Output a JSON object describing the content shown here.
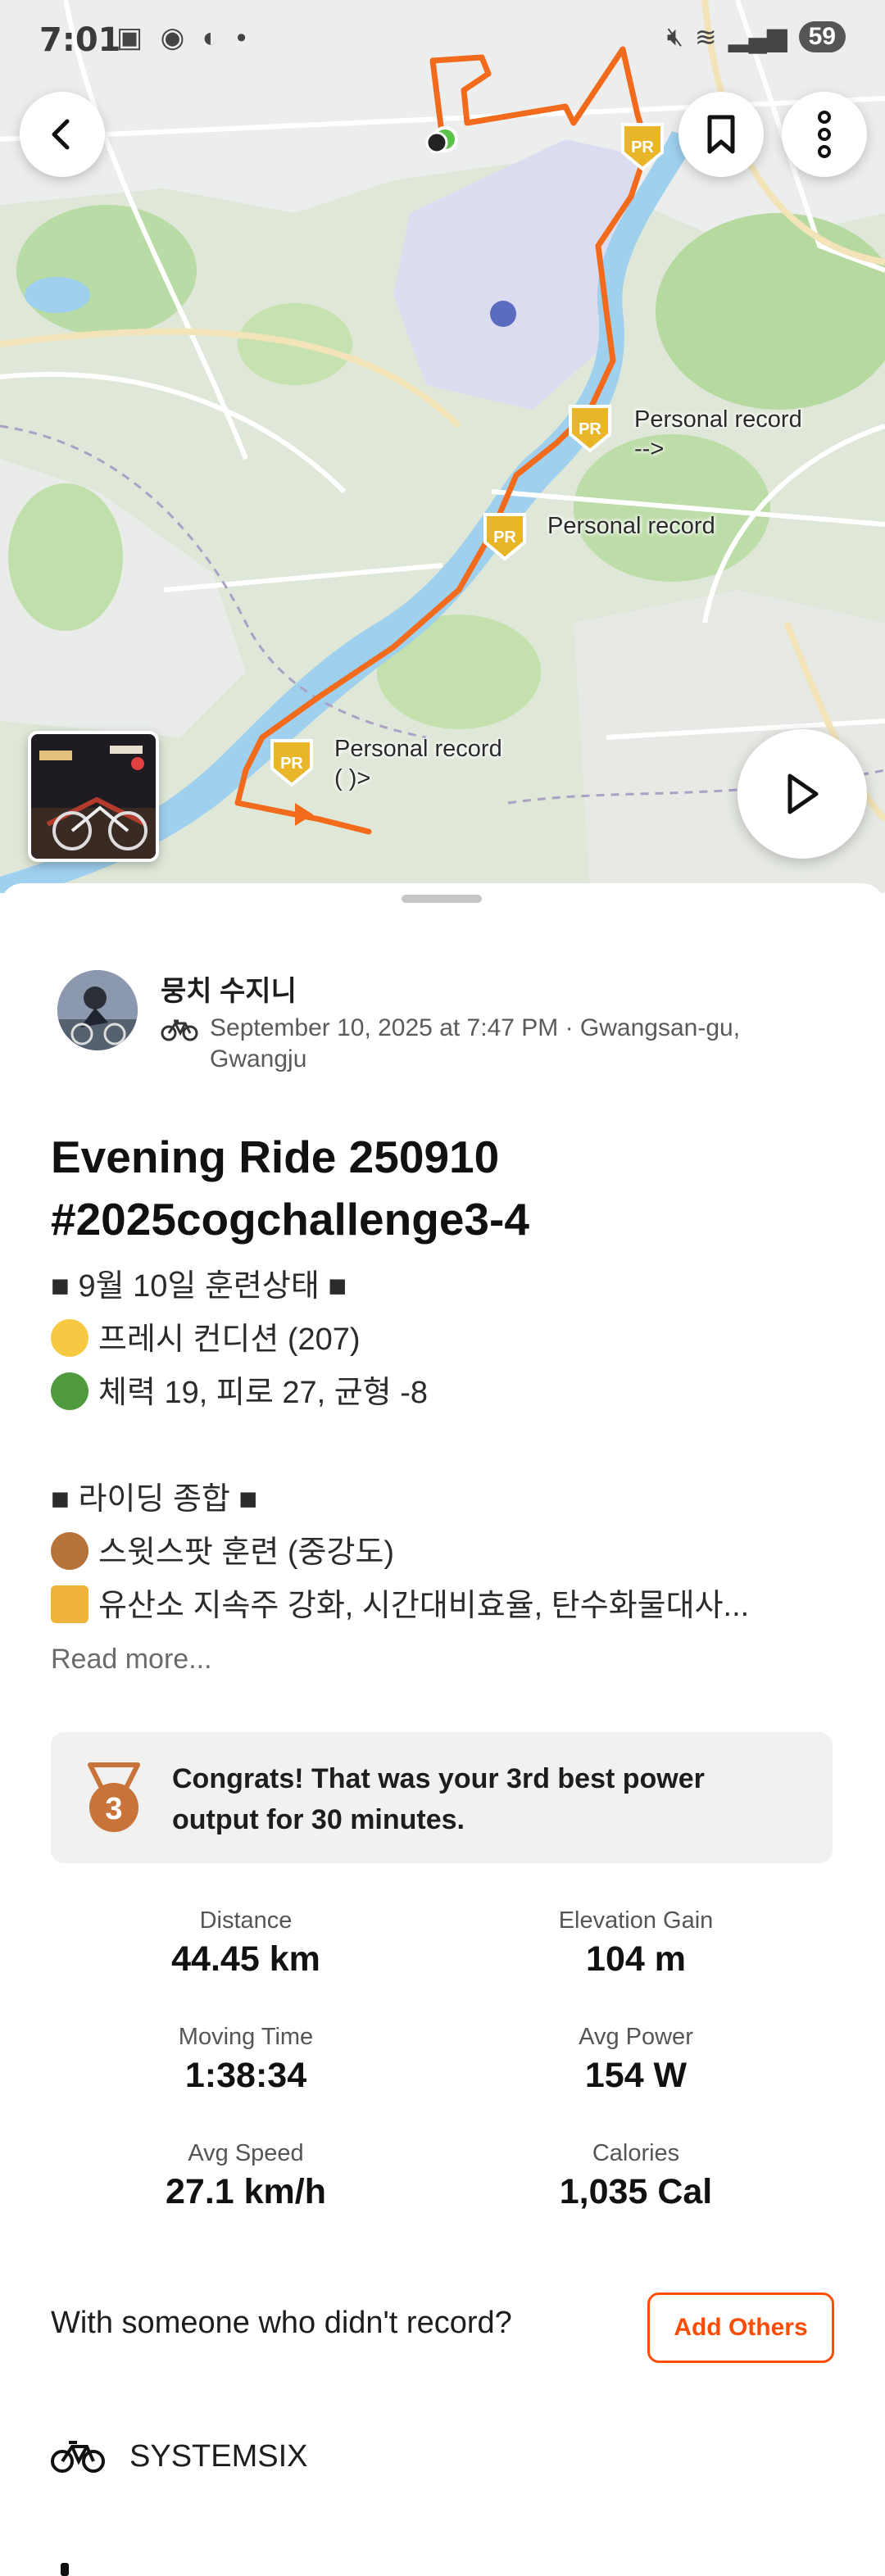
{
  "status_bar": {
    "time": "7:01",
    "battery": "59"
  },
  "map": {
    "pr_labels": [
      "Personal record\n-->",
      "Personal record",
      "Personal record\n( )>"
    ]
  },
  "activity": {
    "athlete_name": "뭉치 수지니",
    "meta": "September 10, 2025 at 7:47 PM · Gwangsan-gu, Gwangju",
    "title": "Evening Ride 250910 #2025cogchallenge3-4",
    "description": [
      {
        "emoji": "",
        "text": "■ 9월 10일 훈련상태 ■"
      },
      {
        "emoji": "neutral-face",
        "text": "프레시 컨디션 (207)"
      },
      {
        "emoji": "tree",
        "text": "체력 19, 피로 27, 균형 -8"
      },
      {
        "emoji": "",
        "text": ""
      },
      {
        "emoji": "",
        "text": "■ 라이딩 종합 ■"
      },
      {
        "emoji": "horse",
        "text": "스윗스팟 훈련 (중강도)"
      },
      {
        "emoji": "label",
        "text": "유산소 지속주 강화, 시간대비효율, 탄수화물대사..."
      }
    ],
    "read_more": "Read more...",
    "achievement": "Congrats! That was your 3rd best power output for 30 minutes.",
    "achievement_rank": "3"
  },
  "stats": [
    {
      "label": "Distance",
      "value": "44.45 km"
    },
    {
      "label": "Elevation Gain",
      "value": "104 m"
    },
    {
      "label": "Moving Time",
      "value": "1:38:34"
    },
    {
      "label": "Avg Power",
      "value": "154 W"
    },
    {
      "label": "Avg Speed",
      "value": "27.1 km/h"
    },
    {
      "label": "Calories",
      "value": "1,035 Cal"
    }
  ],
  "with_someone": "With someone who didn't record?",
  "add_others_label": "Add Others",
  "gear": "SYSTEMSIX",
  "colors": {
    "accent": "#fc4c02",
    "route": "#f26a1b",
    "pr_gold": "#e9b62a",
    "bronze": "#c8733a"
  }
}
